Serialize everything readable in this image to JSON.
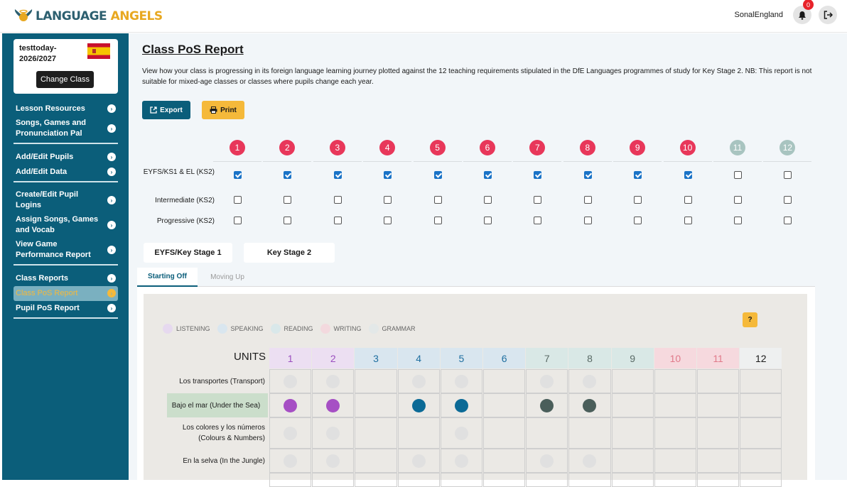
{
  "header": {
    "logo_text_a": "LANGUAGE",
    "logo_text_b": " ANGELS",
    "username": "SonalEngland",
    "notifications": "0"
  },
  "class_card": {
    "name": "testtoday-2026/2027",
    "change_label": "Change Class"
  },
  "sidebar": {
    "groups": [
      [
        {
          "label": "Lesson Resources"
        },
        {
          "label": "Songs, Games and Pronunciation Pal"
        }
      ],
      [
        {
          "label": "Add/Edit Pupils"
        },
        {
          "label": "Add/Edit Data"
        }
      ],
      [
        {
          "label": "Create/Edit Pupil Logins"
        },
        {
          "label": "Assign Songs, Games and Vocab"
        },
        {
          "label": "View Game Performance Report"
        }
      ],
      [
        {
          "label": "Class Reports"
        },
        {
          "label": "Class PoS Report",
          "active": true
        },
        {
          "label": "Pupil PoS Report"
        }
      ]
    ]
  },
  "main": {
    "title": "Class PoS Report",
    "description": "View how your class is progressing in its foreign language learning journey plotted against the 12 teaching requirements stipulated in the DfE Languages programmes of study for Key Stage 2. NB: This report is not suitable for mixed-age classes or classes where pupils change each year.",
    "export_label": "Export",
    "print_label": "Print"
  },
  "requirements": {
    "numbers": [
      "1",
      "2",
      "3",
      "4",
      "5",
      "6",
      "7",
      "8",
      "9",
      "10",
      "11",
      "12"
    ],
    "active_color": "#e8375a",
    "inactive_color": "#a8c4c0",
    "active_count": 10,
    "rows": [
      {
        "label": "EYFS/KS1 & EL (KS2)",
        "checked": [
          true,
          true,
          true,
          true,
          true,
          true,
          true,
          true,
          true,
          true,
          false,
          false
        ]
      },
      {
        "label": "Intermediate (KS2)",
        "checked": [
          false,
          false,
          false,
          false,
          false,
          false,
          false,
          false,
          false,
          false,
          false,
          false
        ]
      },
      {
        "label": "Progressive (KS2)",
        "checked": [
          false,
          false,
          false,
          false,
          false,
          false,
          false,
          false,
          false,
          false,
          false,
          false
        ]
      }
    ]
  },
  "stage_tabs": [
    "EYFS/Key Stage 1",
    "Key Stage 2"
  ],
  "sub_tabs": [
    "Starting Off",
    "Moving Up"
  ],
  "legend": [
    {
      "label": "LISTENING",
      "color": "#e6d9ef"
    },
    {
      "label": "SPEAKING",
      "color": "#d9e6ef"
    },
    {
      "label": "READING",
      "color": "#d9e8ea"
    },
    {
      "label": "WRITING",
      "color": "#f3d9de"
    },
    {
      "label": "GRAMMAR",
      "color": "#e3e8e8"
    }
  ],
  "help_label": "?",
  "units": {
    "label": "UNITS",
    "headers": [
      {
        "n": "1",
        "bg": "#ecdff2",
        "fg": "#9a4fbf"
      },
      {
        "n": "2",
        "bg": "#ecdff2",
        "fg": "#9a4fbf"
      },
      {
        "n": "3",
        "bg": "#d9e6ef",
        "fg": "#1f6fa0"
      },
      {
        "n": "4",
        "bg": "#d9e6ef",
        "fg": "#1f6fa0"
      },
      {
        "n": "5",
        "bg": "#d9e6ef",
        "fg": "#1f6fa0"
      },
      {
        "n": "6",
        "bg": "#d9e6ef",
        "fg": "#1f6fa0"
      },
      {
        "n": "7",
        "bg": "#d9e8e6",
        "fg": "#5a6a66"
      },
      {
        "n": "8",
        "bg": "#d9e8e6",
        "fg": "#5a6a66"
      },
      {
        "n": "9",
        "bg": "#d9e8e6",
        "fg": "#5a6a66"
      },
      {
        "n": "10",
        "bg": "#f6d9de",
        "fg": "#e07a8a"
      },
      {
        "n": "11",
        "bg": "#f6d9de",
        "fg": "#e07a8a"
      },
      {
        "n": "12",
        "bg": "#eef0f0",
        "fg": "#1a1a1a"
      }
    ]
  },
  "topics": [
    {
      "label": "Los transportes (Transport)",
      "dots": [
        "e",
        "e",
        "",
        "e",
        "e",
        "",
        "e",
        "e",
        "",
        "",
        "",
        ""
      ]
    },
    {
      "label": "Bajo el mar (Under the Sea)",
      "highlight": true,
      "dots": [
        "#a64fc4",
        "#a64fc4",
        "",
        "#0b6a96",
        "#0b6a96",
        "",
        "#4a5e5a",
        "#4a5e5a",
        "",
        "",
        "",
        ""
      ]
    },
    {
      "label": "Los colores y los números (Colours & Numbers)",
      "dots": [
        "e",
        "e",
        "",
        "",
        "e",
        "",
        "",
        "",
        "",
        "",
        "",
        ""
      ]
    },
    {
      "label": "En la selva (In the Jungle)",
      "dots": [
        "e",
        "e",
        "",
        "e",
        "e",
        "",
        "e",
        "e",
        "",
        "",
        "",
        ""
      ]
    },
    {
      "label": "",
      "dots": [
        "",
        "",
        "",
        "",
        "",
        "",
        "",
        "",
        "",
        "",
        "",
        ""
      ]
    }
  ]
}
